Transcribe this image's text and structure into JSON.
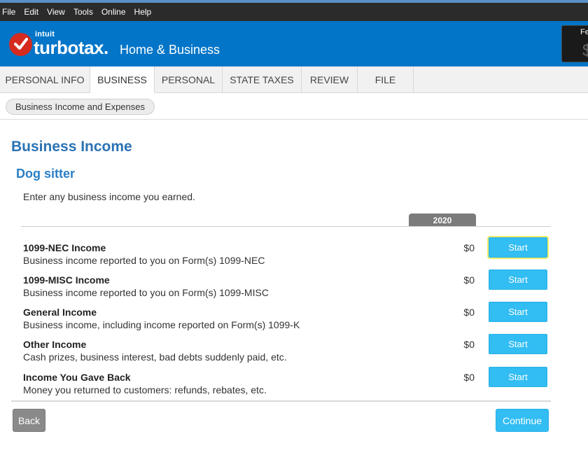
{
  "menubar": {
    "items": [
      "File",
      "Edit",
      "View",
      "Tools",
      "Online",
      "Help"
    ]
  },
  "header": {
    "brand_parent": "intuit",
    "brand": "turbotax.",
    "edition": "Home & Business",
    "refund_label": "Fe",
    "refund_amount": "$",
    "brand_color": "#0275c8",
    "logo_color": "#d52b1e"
  },
  "tabs": [
    {
      "label": "PERSONAL INFO",
      "active": false
    },
    {
      "label": "BUSINESS",
      "active": true
    },
    {
      "label": "PERSONAL",
      "active": false
    },
    {
      "label": "STATE TAXES",
      "active": false
    },
    {
      "label": "REVIEW",
      "active": false
    },
    {
      "label": "FILE",
      "active": false
    }
  ],
  "subnav": {
    "pill_label": "Business Income and Expenses"
  },
  "main": {
    "title": "Business Income",
    "business_name": "Dog sitter",
    "instruction": "Enter any business income you earned.",
    "year": "2020",
    "rows": [
      {
        "title": "1099-NEC Income",
        "description": "Business income reported to you on Form(s) 1099-NEC",
        "amount": "$0",
        "button": "Start"
      },
      {
        "title": "1099-MISC Income",
        "description": "Business income reported to you on Form(s) 1099-MISC",
        "amount": "$0",
        "button": "Start"
      },
      {
        "title": "General Income",
        "description": "Business income, including income reported on Form(s) 1099-K",
        "amount": "$0",
        "button": "Start"
      },
      {
        "title": "Other Income",
        "description": "Cash prizes, business interest, bad debts suddenly paid, etc.",
        "amount": "$0",
        "button": "Start"
      },
      {
        "title": "Income You Gave Back",
        "description": "Money you returned to customers: refunds, rebates, etc.",
        "amount": "$0",
        "button": "Start"
      }
    ]
  },
  "footer": {
    "back_label": "Back",
    "continue_label": "Continue",
    "accent_color": "#32bdf3"
  }
}
